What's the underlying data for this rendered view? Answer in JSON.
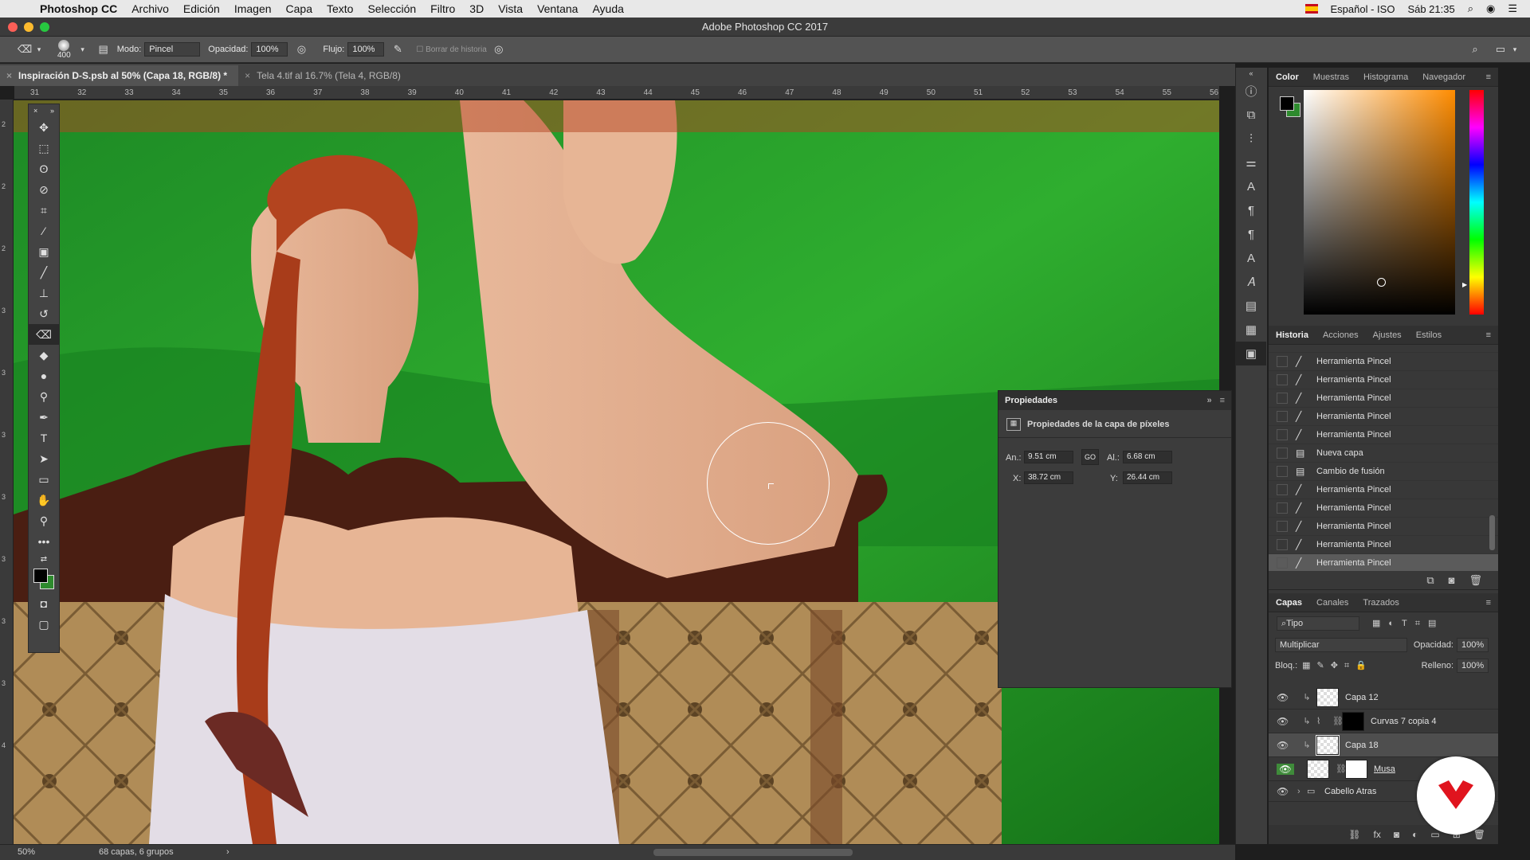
{
  "menubar": {
    "app": "Photoshop CC",
    "items": [
      "Archivo",
      "Edición",
      "Imagen",
      "Capa",
      "Texto",
      "Selección",
      "Filtro",
      "3D",
      "Vista",
      "Ventana",
      "Ayuda"
    ],
    "input_source": "Español - ISO",
    "clock": "Sáb 21:35"
  },
  "window": {
    "title": "Adobe Photoshop CC 2017"
  },
  "options": {
    "brush_size": "400",
    "mode_label": "Modo:",
    "mode_value": "Pincel",
    "opacity_label": "Opacidad:",
    "opacity_value": "100%",
    "flow_label": "Flujo:",
    "flow_value": "100%",
    "history_label": "Borrar de historia"
  },
  "tabs": [
    {
      "label": "Inspiración D-S.psb al 50% (Capa 18, RGB/8) *"
    },
    {
      "label": "Tela 4.tif al 16.7% (Tela 4, RGB/8)"
    }
  ],
  "ruler_top": [
    "31",
    "32",
    "33",
    "34",
    "35",
    "36",
    "37",
    "38",
    "39",
    "40",
    "41",
    "42",
    "43",
    "44",
    "45",
    "46",
    "47",
    "48",
    "49",
    "50",
    "51",
    "52",
    "53",
    "54",
    "55",
    "56"
  ],
  "ruler_left": [
    "2",
    "2",
    "2",
    "3",
    "3",
    "3",
    "3",
    "3",
    "3",
    "3",
    "4"
  ],
  "properties": {
    "title": "Propiedades",
    "subtitle": "Propiedades de la capa de píxeles",
    "w_label": "An.:",
    "w_value": "9.51 cm",
    "link_label": "GO",
    "h_label": "Al.:",
    "h_value": "6.68 cm",
    "x_label": "X:",
    "x_value": "38.72 cm",
    "y_label": "Y:",
    "y_value": "26.44 cm"
  },
  "color_panel": {
    "tabs": [
      "Color",
      "Muestras",
      "Histograma",
      "Navegador"
    ],
    "foreground": "#000000",
    "background": "#2e8b2e"
  },
  "history_panel": {
    "tabs": [
      "Historia",
      "Acciones",
      "Ajustes",
      "Estilos"
    ],
    "items": [
      {
        "label": "Herramienta Pincel",
        "icon": "brush-icon"
      },
      {
        "label": "Herramienta Pincel",
        "icon": "brush-icon"
      },
      {
        "label": "Herramienta Pincel",
        "icon": "brush-icon"
      },
      {
        "label": "Herramienta Pincel",
        "icon": "brush-icon"
      },
      {
        "label": "Herramienta Pincel",
        "icon": "brush-icon"
      },
      {
        "label": "Nueva capa",
        "icon": "layer-icon"
      },
      {
        "label": "Cambio de fusión",
        "icon": "layer-icon"
      },
      {
        "label": "Herramienta Pincel",
        "icon": "brush-icon"
      },
      {
        "label": "Herramienta Pincel",
        "icon": "brush-icon"
      },
      {
        "label": "Herramienta Pincel",
        "icon": "brush-icon"
      },
      {
        "label": "Herramienta Pincel",
        "icon": "brush-icon"
      },
      {
        "label": "Herramienta Pincel",
        "icon": "brush-icon"
      }
    ]
  },
  "layers_panel": {
    "tabs": [
      "Capas",
      "Canales",
      "Trazados"
    ],
    "filter": "Tipo",
    "blend_mode": "Multiplicar",
    "opacity_label": "Opacidad:",
    "opacity_value": "100%",
    "lock_label": "Bloq.:",
    "fill_label": "Relleno:",
    "fill_value": "100%",
    "layers": [
      {
        "name": "Capa 12"
      },
      {
        "name": "Curvas 7 copia 4"
      },
      {
        "name": "Capa 18"
      },
      {
        "name": "Musa"
      },
      {
        "name": "Cabello Atras"
      }
    ]
  },
  "status": {
    "zoom": "50%",
    "doc_info": "68 capas, 6 grupos"
  }
}
